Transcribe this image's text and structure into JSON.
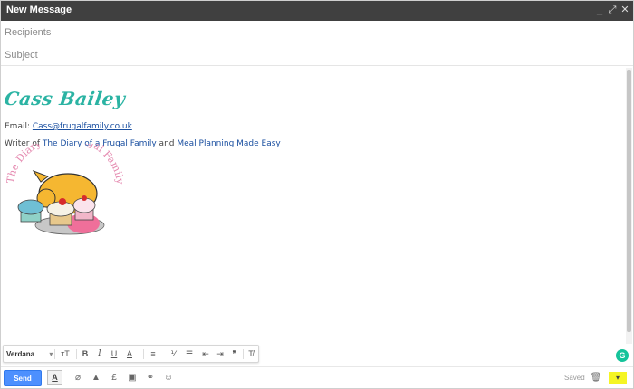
{
  "window": {
    "title": "New Message",
    "controls": [
      "_",
      "⤢",
      "✕"
    ]
  },
  "recipients": {
    "placeholder": "Recipients"
  },
  "subject": {
    "placeholder": "Subject"
  },
  "signature": {
    "name": "Cass Bailey",
    "email_prefix": "Email: ",
    "email": "Cass@frugalfamily.co.uk",
    "writer_prefix": "Writer of ",
    "book1": "The Diary of a Frugal Family",
    "and": " and ",
    "book2": "Meal Planning Made Easy",
    "logo_text": "The Diary Of A Frugal Family"
  },
  "formatting": {
    "font": "Verdana",
    "font_caret": "▾",
    "size": "тT",
    "bold": "B",
    "italic": "I",
    "underline": "U",
    "text_color": "A",
    "align": "≡",
    "numbered": "⅟",
    "bulleted": "☰",
    "indent_less": "⇤",
    "indent_more": "⇥",
    "quote": "❞",
    "clear": "T̸"
  },
  "bottom": {
    "send": "Send",
    "format_toggle": "A",
    "attach": "⌀",
    "drive": "▲",
    "money": "£",
    "photo": "▣",
    "link": "⚭",
    "emoji": "☺",
    "saved": "Saved",
    "trash": "🗑",
    "more": "▾"
  },
  "grammarly": "G",
  "colors": {
    "titlebar": "#404040",
    "send": "#4d90fe",
    "signature_name": "#2bb3a3",
    "link": "#1a4fa0",
    "highlight": "#f5f524"
  }
}
